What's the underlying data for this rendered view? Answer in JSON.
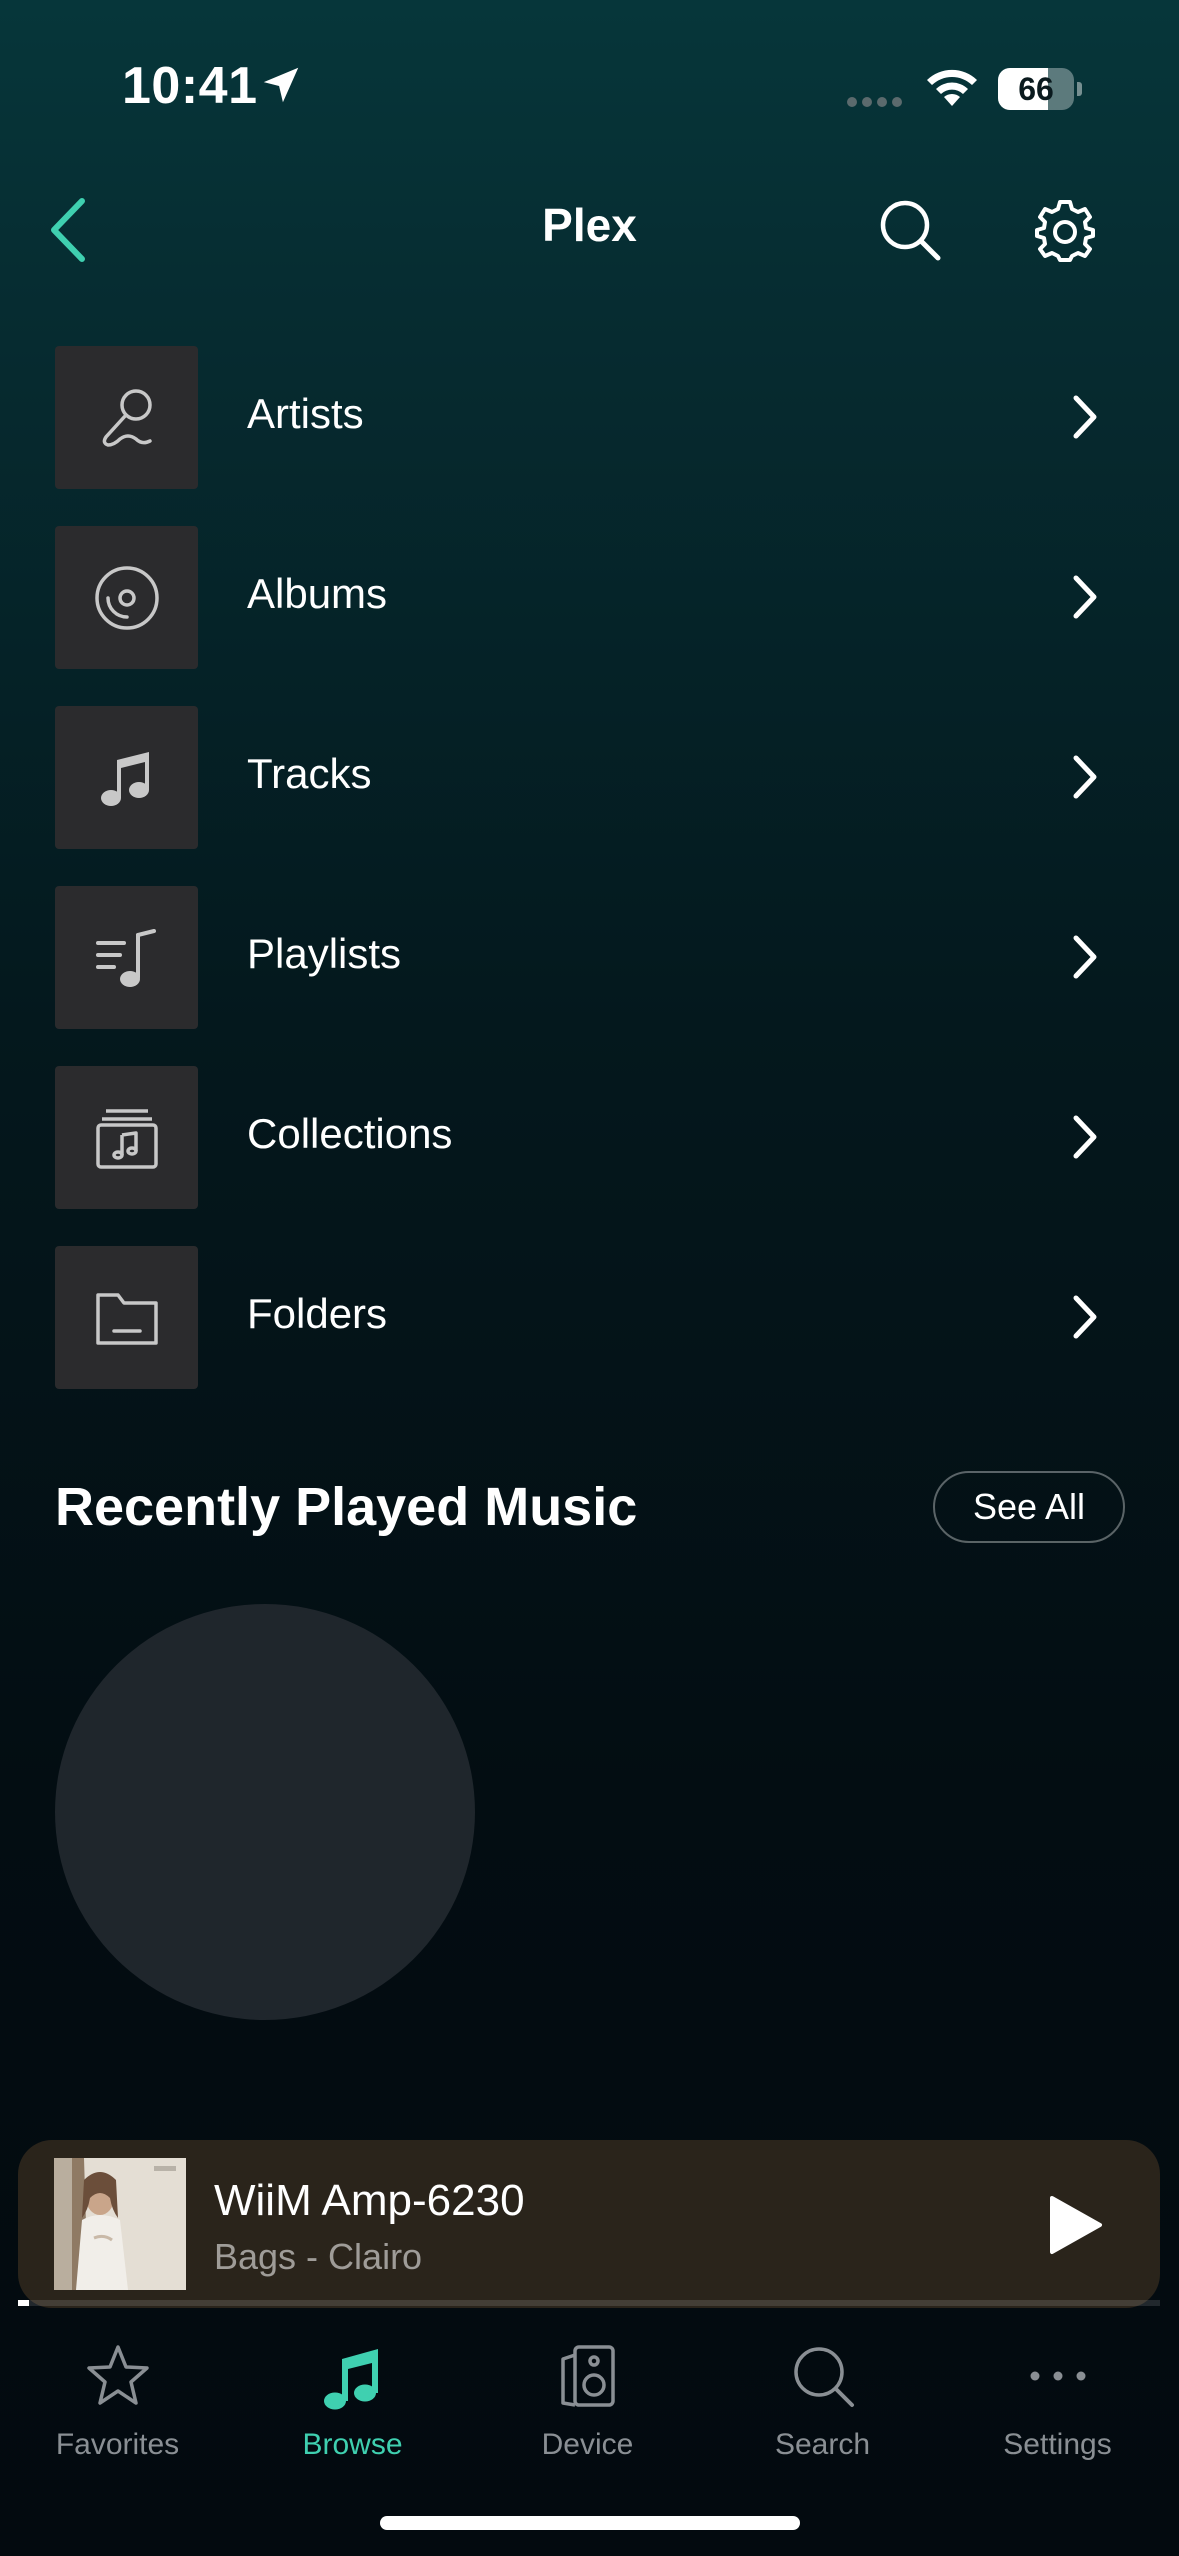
{
  "status_bar": {
    "time": "10:41",
    "battery_percent": "66",
    "battery_level": 0.66
  },
  "header": {
    "title": "Plex"
  },
  "browse_items": [
    {
      "label": "Artists",
      "icon": "microphone-icon"
    },
    {
      "label": "Albums",
      "icon": "disc-icon"
    },
    {
      "label": "Tracks",
      "icon": "music-note-icon"
    },
    {
      "label": "Playlists",
      "icon": "playlist-icon"
    },
    {
      "label": "Collections",
      "icon": "collection-icon"
    },
    {
      "label": "Folders",
      "icon": "folder-icon"
    }
  ],
  "recent": {
    "title": "Recently Played Music",
    "see_all_label": "See All"
  },
  "mini_player": {
    "device": "WiiM Amp-6230",
    "track": "Bags - Clairo",
    "progress": 0.01,
    "art_icon": "album-art"
  },
  "tabs": [
    {
      "label": "Favorites",
      "icon": "star-icon",
      "active": false
    },
    {
      "label": "Browse",
      "icon": "music-note-icon",
      "active": true
    },
    {
      "label": "Device",
      "icon": "speaker-icon",
      "active": false
    },
    {
      "label": "Search",
      "icon": "search-icon",
      "active": false
    },
    {
      "label": "Settings",
      "icon": "more-icon",
      "active": false
    }
  ],
  "colors": {
    "accent": "#3fd0b0",
    "thumb_bg": "#2b2b2d",
    "mini_player_bg": "#2a241b",
    "inactive_tab": "#8a8f94"
  }
}
